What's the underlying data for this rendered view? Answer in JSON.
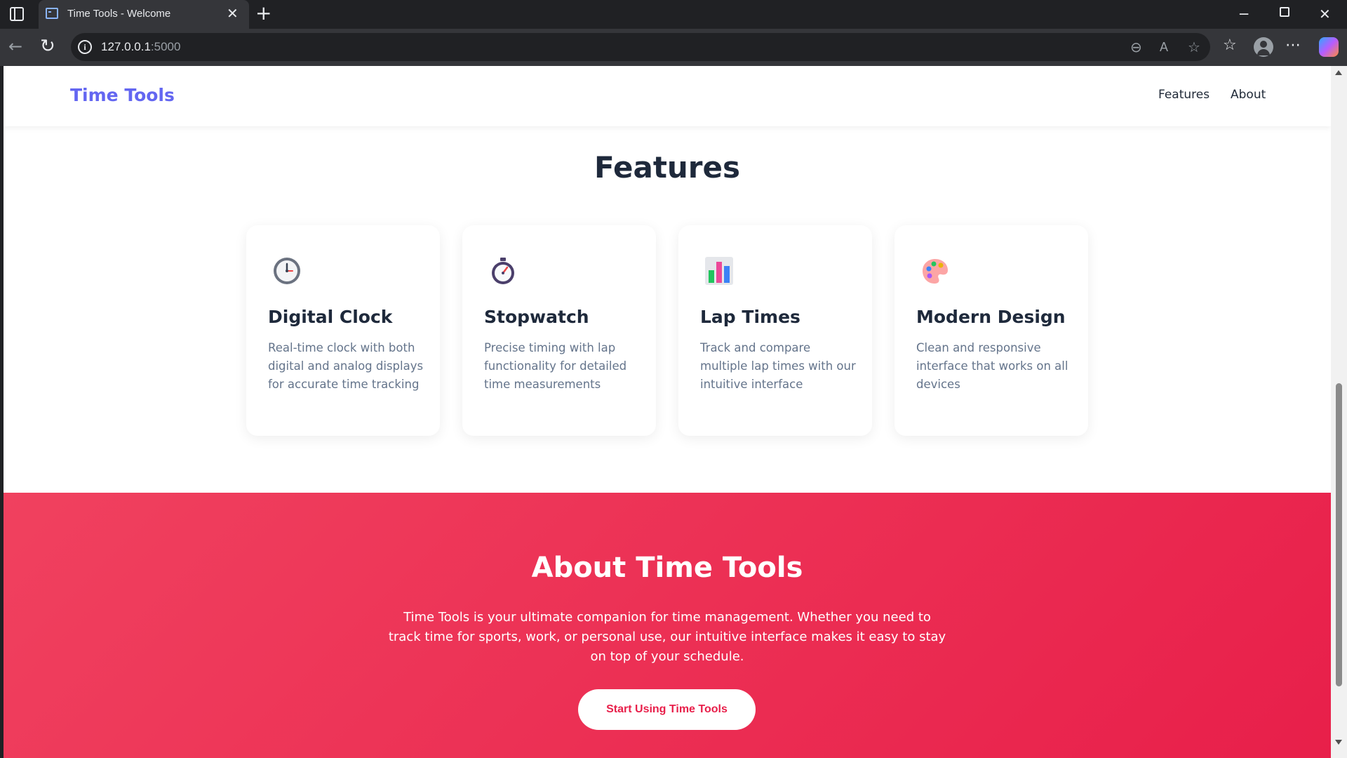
{
  "browser": {
    "tab_title": "Time Tools - Welcome",
    "close_glyph": "✕",
    "new_tab_glyph": "+",
    "back_glyph": "←",
    "reload_glyph": "↻",
    "url_host": "127.0.0.1",
    "url_port": ":5000",
    "info_glyph": "i",
    "zoom_glyph": "⊖",
    "read_aloud_glyph": "A",
    "star_glyph": "☆",
    "favorites_glyph": "☆",
    "more_glyph": "⋯",
    "minimize_glyph": "─",
    "window_close_glyph": "✕"
  },
  "header": {
    "logo": "Time Tools",
    "nav": [
      "Features",
      "About"
    ]
  },
  "features": {
    "title": "Features",
    "cards": [
      {
        "icon": "clock-icon",
        "title": "Digital Clock",
        "description": "Real-time clock with both digital and analog displays for accurate time tracking"
      },
      {
        "icon": "stopwatch-icon",
        "title": "Stopwatch",
        "description": "Precise timing with lap functionality for detailed time measurements"
      },
      {
        "icon": "bar-chart-icon",
        "title": "Lap Times",
        "description": "Track and compare multiple lap times with our intuitive interface"
      },
      {
        "icon": "palette-icon",
        "title": "Modern Design",
        "description": "Clean and responsive interface that works on all devices"
      }
    ]
  },
  "about": {
    "title": "About Time Tools",
    "text": "Time Tools is your ultimate companion for time management. Whether you need to track time for sports, work, or personal use, our intuitive interface makes it easy to stay on top of your schedule.",
    "cta_label": "Start Using Time Tools"
  },
  "colors": {
    "brand": "#6366f1",
    "accent": "#e81f4a",
    "heading": "#1e293b",
    "body_text": "#64748b"
  }
}
